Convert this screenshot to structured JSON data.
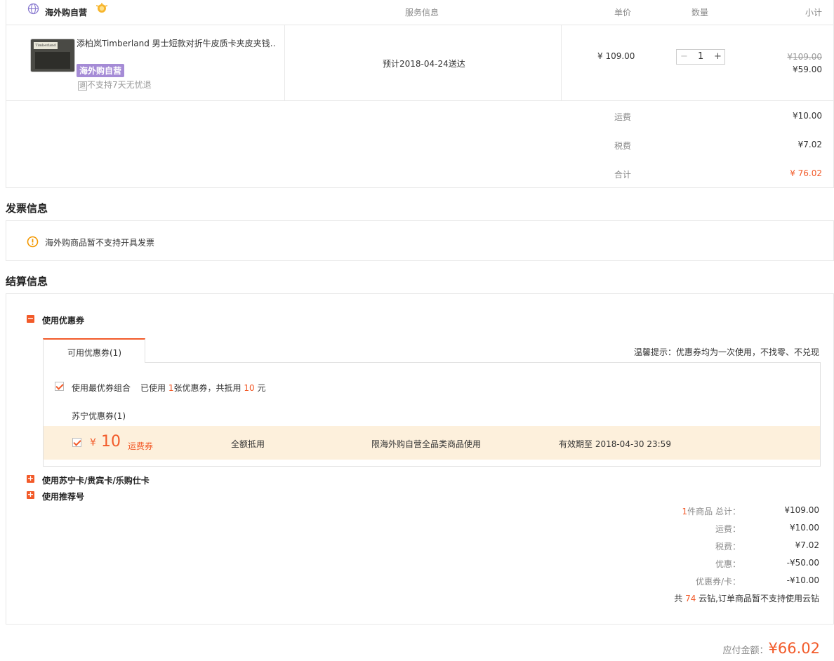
{
  "store": {
    "name": "海外购自营"
  },
  "table_headers": {
    "service": "服务信息",
    "price": "单价",
    "qty": "数量",
    "subtotal": "小计"
  },
  "product": {
    "thumb_label": "Timberland",
    "title": "添柏岚Timberland 男士短款对折牛皮质卡夹皮夹钱…",
    "badge": "海外购自营",
    "return_icon": "退",
    "return_policy": "不支持7天无忧退",
    "delivery": "预计2018-04-24送达",
    "unit_price": "¥ 109.00",
    "qty_minus": "−",
    "quantity": "1",
    "qty_plus": "+",
    "original_price": "¥109.00",
    "subtotal": "¥59.00"
  },
  "fees": {
    "shipping_label": "运费",
    "shipping": "¥10.00",
    "tax_label": "税费",
    "tax": "¥7.02",
    "total_label": "合计",
    "total": "¥ 76.02"
  },
  "invoice": {
    "title": "发票信息",
    "note": "海外购商品暂不支持开具发票"
  },
  "settlement": {
    "title": "结算信息",
    "use_coupon": "使用优惠券",
    "tab_label": "可用优惠券(1)",
    "tip": "温馨提示：优惠券均为一次使用，不找零、不兑现",
    "best_combo": "使用最优券组合",
    "used_prefix": "已使用",
    "used_count": "1",
    "used_mid": "张优惠券，共抵用",
    "used_amount": "10",
    "used_suffix": "元",
    "group_label": "苏宁优惠券(1)",
    "coupon": {
      "currency": "¥",
      "amount": "10",
      "type": "运费券",
      "scope": "全额抵用",
      "restriction": "限海外购自营全品类商品使用",
      "expiry": "有效期至 2018-04-30 23:59"
    },
    "use_cards": "使用苏宁卡/贵宾卡/乐购仕卡",
    "use_referral": "使用推荐号",
    "expand_icon": "+",
    "collapse_icon": "−"
  },
  "summary": {
    "item_count": "1",
    "items_label": "件商品 总计：",
    "items_total": "¥109.00",
    "shipping_label": "运费：",
    "shipping": "¥10.00",
    "tax_label": "税费：",
    "tax": "¥7.02",
    "discount_label": "优惠：",
    "discount": "-¥50.00",
    "coupon_label": "优惠券/卡：",
    "coupon": "-¥10.00",
    "yunzuan_prefix": "共",
    "yunzuan_count": "74",
    "yunzuan_suffix": "云钻,订单商品暂不支持使用云钻"
  },
  "payable": {
    "label": "应付金额：",
    "amount": "¥66.02"
  },
  "colors": {
    "accent": "#f25a29",
    "badge": "#a58bd6",
    "coupon_bg": "#fdf0dc"
  }
}
